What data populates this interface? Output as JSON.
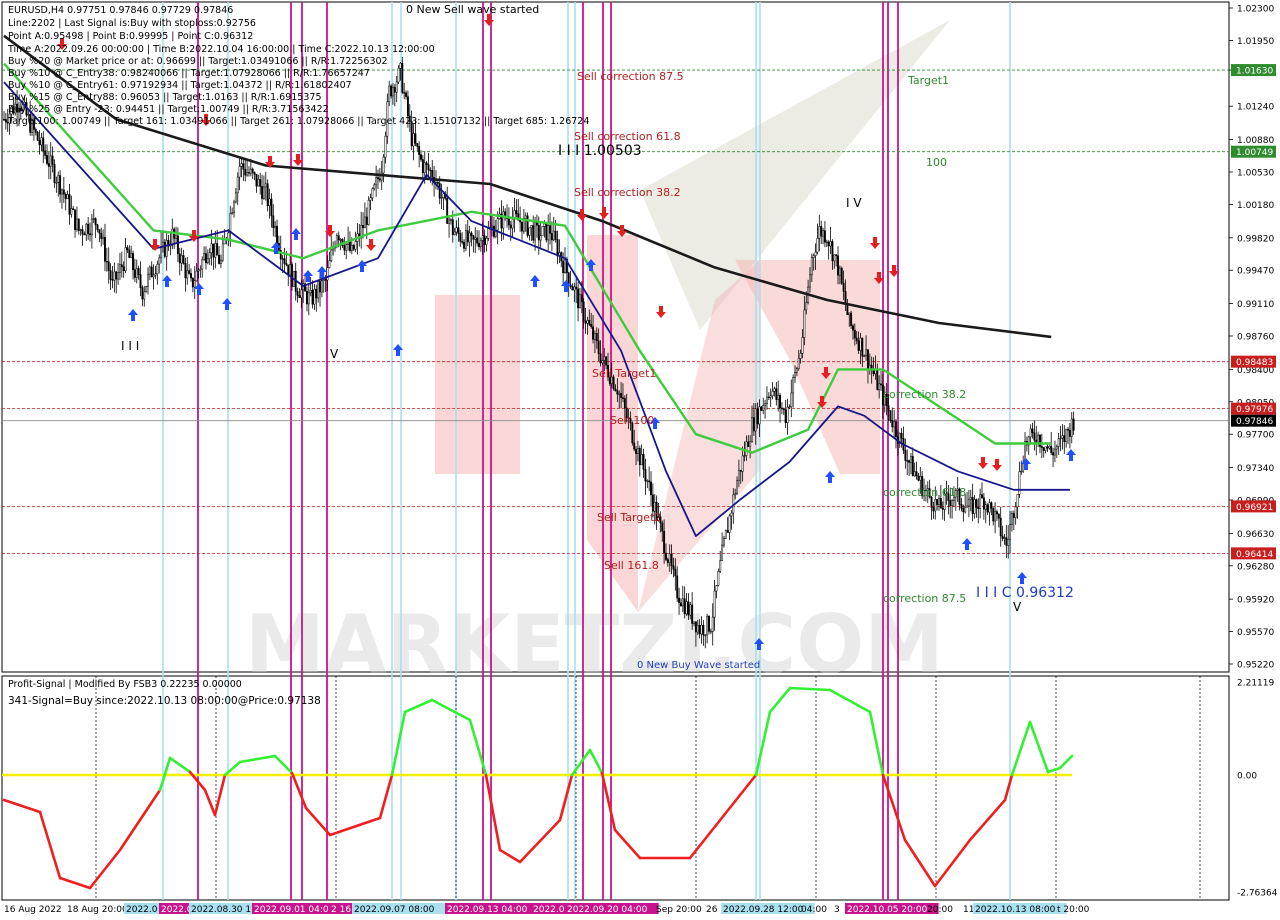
{
  "header": {
    "symbol_line": "EURUSD,H4  0.97751 0.97846 0.97729 0.97846",
    "info_lines": [
      "Line:2202 | Last Signal is:Buy with stoploss:0.92756",
      "Point A:0.95498 | Point B:0.99995 | Point C:0.96312",
      "Time A:2022.09.26 00:00:00 | Time B:2022.10.04 16:00:00 | Time C:2022.10.13 12:00:00",
      "Buy %20 @ Market price or at: 0.96699 || Target:1.03491066 || R/R:1.72256302",
      "Buy %10 @ C_Entry38: 0.98240066 || Target:1.07928066 || R/R:1.76657247",
      "Buy %10 @ C_Entry61: 0.97192934 || Target:1.04372 || R/R:1.61802407",
      "Buy %15 @ C_Entry88: 0.96053 || Target:1.0163 || R/R:1.6915375",
      "Buy %25 @ Entry -23: 0.94451 || Target:1.00749 || R/R:3.71563422",
      "Target100: 1.00749 || Target 161: 1.03491066 || Target 261: 1.07928066 || Target 423: 1.15107132 || Target 685: 1.26724"
    ]
  },
  "annotations": {
    "sell_wave": "0 New Sell wave started",
    "buy_wave": "0 New Buy Wave started",
    "sell_corr_875": "Sell correction 87.5",
    "sell_corr_618": "Sell correction 61.8",
    "sell_corr_382": "Sell correction 38.2",
    "level_label": "I I I 1.00503",
    "target1": "Target1",
    "hundred": "100",
    "sell_target1": "Sell Target1",
    "sell_100": "Sell 100",
    "sell_target2": "Sell Target2",
    "sell_1618": "Sell 161.8",
    "corr_382": "correction 38.2",
    "corr_618": "correction 61.8",
    "corr_875": "correction 87.5",
    "c_label": "I I I C 0.96312",
    "wave_iii": "I I I",
    "wave_v1": "V",
    "wave_iv": "I V",
    "wave_v2": "V",
    "watermark": "MARKETZI.COM"
  },
  "price_axis": {
    "ticks": [
      "1.02300",
      "1.01950",
      "1.01630",
      "1.01240",
      "1.00880",
      "1.00530",
      "1.00180",
      "0.99820",
      "0.99470",
      "0.99110",
      "0.98760",
      "0.98400",
      "0.98050",
      "0.97700",
      "0.97340",
      "0.96990",
      "0.96630",
      "0.96280",
      "0.95920",
      "0.95570",
      "0.95220"
    ],
    "highlight_levels": [
      {
        "value": "1.01630",
        "color": "#2e8b2e"
      },
      {
        "value": "1.00749",
        "color": "#2e8b2e"
      },
      {
        "value": "0.98483",
        "color": "#c81e1e"
      },
      {
        "value": "0.97976",
        "color": "#c81e1e"
      },
      {
        "value": "0.97846",
        "color": "#000000"
      },
      {
        "value": "0.96921",
        "color": "#c81e1e"
      },
      {
        "value": "0.96414",
        "color": "#c81e1e"
      }
    ]
  },
  "indicator": {
    "title": "Profit-Signal | Modified By FSB3 0.22235 0.00000",
    "signal": "341-Signal=Buy since:2022.10.13 08:00:00@Price:0.97138",
    "axis": [
      "2.21119",
      "0.00",
      "-2.76364"
    ]
  },
  "time_axis": [
    {
      "label": "16 Aug 2022",
      "kind": "plain"
    },
    {
      "label": "18 Aug 20:00",
      "kind": "plain"
    },
    {
      "label": "2022.0",
      "kind": "cyan"
    },
    {
      "label": "2022.0",
      "kind": "magenta"
    },
    {
      "label": "2022.08.30 1",
      "kind": "cyan"
    },
    {
      "label": "2022.09.01 04:00",
      "kind": "magenta"
    },
    {
      "label": "2 16",
      "kind": "magenta"
    },
    {
      "label": "2022.09.07 08:00",
      "kind": "cyan"
    },
    {
      "label": "2022.09.13 04:00",
      "kind": "magenta"
    },
    {
      "label": "2022.0",
      "kind": "magenta"
    },
    {
      "label": "2022.09.20 04:00",
      "kind": "magenta"
    },
    {
      "label": "Sep 20:00",
      "kind": "plain"
    },
    {
      "label": "26",
      "kind": "plain"
    },
    {
      "label": "2022.09.28 12:00",
      "kind": "cyan"
    },
    {
      "label": "04:00",
      "kind": "plain"
    },
    {
      "label": "3",
      "kind": "plain"
    },
    {
      "label": "2022.10.05 20:00",
      "kind": "magenta"
    },
    {
      "label": "20:00",
      "kind": "plain"
    },
    {
      "label": "11",
      "kind": "plain"
    },
    {
      "label": "2022.10.13 08:00",
      "kind": "cyan"
    },
    {
      "label": "t 20:00",
      "kind": "plain"
    }
  ],
  "colors": {
    "ma_black": "#1a1a1a",
    "ma_green": "#3ccc3c",
    "ma_blue": "#16168c",
    "vline_magenta": "#c8148c",
    "vline_cyan": "#a8e0f0",
    "sell_zone": "#f5b4b4",
    "buy_arrow": "#1e50ff",
    "sell_arrow": "#e61e1e",
    "osc_up": "#32f032",
    "osc_down": "#f01e1e",
    "zero_line": "#f5f000"
  },
  "chart_data": {
    "type": "candlestick",
    "symbol": "EURUSD",
    "timeframe": "H4",
    "ohlc_last": {
      "open": 0.97751,
      "high": 0.97846,
      "low": 0.97729,
      "close": 0.97846
    },
    "price_range": [
      0.9522,
      1.023
    ],
    "close_path": [
      [
        0,
        1.011
      ],
      [
        8,
        1.013
      ],
      [
        20,
        1.008
      ],
      [
        30,
        1.004
      ],
      [
        40,
        0.999
      ],
      [
        50,
        1.0
      ],
      [
        58,
        0.993
      ],
      [
        66,
        0.9965
      ],
      [
        74,
        0.9925
      ],
      [
        80,
        0.995
      ],
      [
        90,
        0.9985
      ],
      [
        100,
        0.993
      ],
      [
        110,
        0.9975
      ],
      [
        116,
        0.9955
      ],
      [
        126,
        1.006
      ],
      [
        132,
        1.005
      ],
      [
        140,
        1.003
      ],
      [
        148,
        0.997
      ],
      [
        156,
        0.993
      ],
      [
        164,
        0.9915
      ],
      [
        172,
        0.9935
      ],
      [
        178,
        0.999
      ],
      [
        186,
        0.9965
      ],
      [
        194,
        1.0005
      ],
      [
        202,
        1.006
      ],
      [
        206,
        1.014
      ],
      [
        212,
        1.016
      ],
      [
        218,
        1.009
      ],
      [
        224,
        1.006
      ],
      [
        230,
        1.005
      ],
      [
        240,
        0.999
      ],
      [
        250,
        0.9975
      ],
      [
        260,
        0.999
      ],
      [
        268,
        1.0005
      ],
      [
        276,
        1.0
      ],
      [
        286,
        0.9985
      ],
      [
        292,
        0.999
      ],
      [
        298,
        0.996
      ],
      [
        306,
        0.992
      ],
      [
        314,
        0.988
      ],
      [
        320,
        0.985
      ],
      [
        328,
        0.982
      ],
      [
        336,
        0.977
      ],
      [
        344,
        0.972
      ],
      [
        352,
        0.966
      ],
      [
        360,
        0.96
      ],
      [
        366,
        0.958
      ],
      [
        372,
        0.956
      ],
      [
        378,
        0.9565
      ],
      [
        384,
        0.964
      ],
      [
        392,
        0.972
      ],
      [
        400,
        0.978
      ],
      [
        410,
        0.982
      ],
      [
        418,
        0.979
      ],
      [
        426,
        0.986
      ],
      [
        432,
        0.996
      ],
      [
        436,
        0.999
      ],
      [
        440,
        0.9985
      ],
      [
        446,
        0.995
      ],
      [
        452,
        0.989
      ],
      [
        460,
        0.986
      ],
      [
        468,
        0.982
      ],
      [
        476,
        0.978
      ],
      [
        484,
        0.974
      ],
      [
        492,
        0.971
      ],
      [
        500,
        0.969
      ],
      [
        508,
        0.9705
      ],
      [
        516,
        0.969
      ],
      [
        524,
        0.97
      ],
      [
        530,
        0.968
      ],
      [
        536,
        0.965
      ],
      [
        540,
        0.969
      ],
      [
        546,
        0.976
      ],
      [
        552,
        0.977
      ],
      [
        560,
        0.975
      ],
      [
        566,
        0.9762
      ],
      [
        572,
        0.9785
      ]
    ],
    "moving_averages": [
      {
        "name": "black",
        "path": [
          [
            0,
            1.02
          ],
          [
            60,
            1.011
          ],
          [
            140,
            1.006
          ],
          [
            200,
            1.005
          ],
          [
            260,
            1.004
          ],
          [
            320,
            1.0
          ],
          [
            380,
            0.995
          ],
          [
            440,
            0.9915
          ],
          [
            500,
            0.989
          ],
          [
            560,
            0.9875
          ]
        ]
      },
      {
        "name": "green",
        "path": [
          [
            0,
            1.017
          ],
          [
            40,
            1.008
          ],
          [
            80,
            0.999
          ],
          [
            120,
            0.998
          ],
          [
            160,
            0.996
          ],
          [
            200,
            0.999
          ],
          [
            250,
            1.001
          ],
          [
            300,
            0.9995
          ],
          [
            340,
            0.986
          ],
          [
            370,
            0.977
          ],
          [
            400,
            0.975
          ],
          [
            430,
            0.9775
          ],
          [
            446,
            0.984
          ],
          [
            470,
            0.984
          ],
          [
            500,
            0.98
          ],
          [
            530,
            0.976
          ],
          [
            560,
            0.976
          ]
        ]
      },
      {
        "name": "blue",
        "path": [
          [
            0,
            1.015
          ],
          [
            40,
            1.006
          ],
          [
            80,
            0.997
          ],
          [
            120,
            0.999
          ],
          [
            160,
            0.993
          ],
          [
            200,
            0.996
          ],
          [
            226,
            1.005
          ],
          [
            250,
            1.0
          ],
          [
            300,
            0.996
          ],
          [
            330,
            0.986
          ],
          [
            354,
            0.973
          ],
          [
            370,
            0.966
          ],
          [
            394,
            0.97
          ],
          [
            420,
            0.974
          ],
          [
            446,
            0.98
          ],
          [
            460,
            0.979
          ],
          [
            480,
            0.976
          ],
          [
            510,
            0.973
          ],
          [
            540,
            0.971
          ],
          [
            570,
            0.971
          ]
        ]
      }
    ]
  }
}
